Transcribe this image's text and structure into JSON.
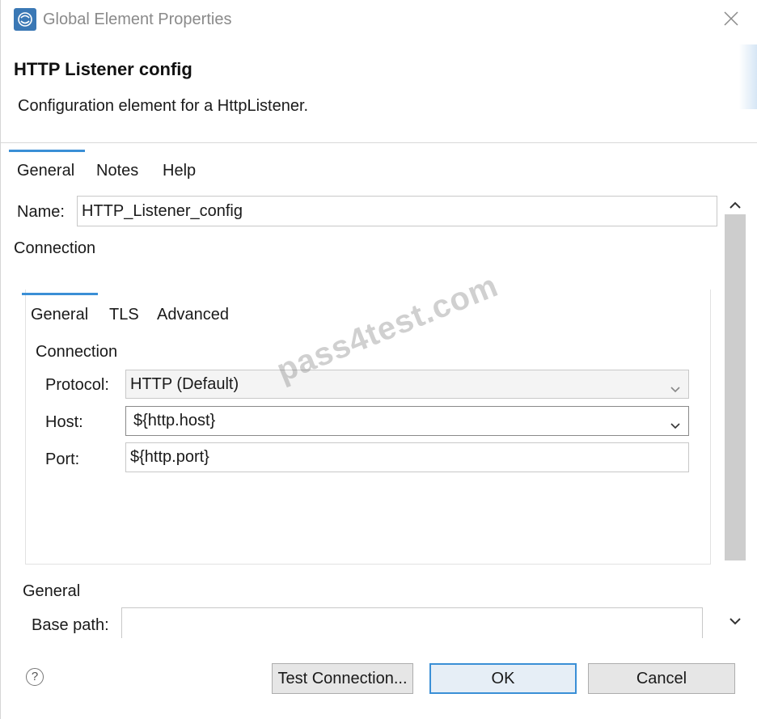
{
  "window": {
    "title": "Global Element Properties"
  },
  "header": {
    "title": "HTTP Listener config",
    "description": "Configuration element for a HttpListener."
  },
  "tabs": [
    {
      "label": "General",
      "active": true
    },
    {
      "label": "Notes",
      "active": false
    },
    {
      "label": "Help",
      "active": false
    }
  ],
  "name_field": {
    "label": "Name:",
    "value": "HTTP_Listener_config"
  },
  "connection_section_label": "Connection",
  "inner_tabs": [
    {
      "label": "General",
      "active": true
    },
    {
      "label": "TLS",
      "active": false
    },
    {
      "label": "Advanced",
      "active": false
    }
  ],
  "connection": {
    "group_label": "Connection",
    "protocol": {
      "label": "Protocol:",
      "value": "HTTP (Default)"
    },
    "host": {
      "label": "Host:",
      "value": "${http.host}"
    },
    "port": {
      "label": "Port:",
      "value": "${http.port}"
    }
  },
  "general_section": {
    "label": "General",
    "base_path": {
      "label": "Base path:",
      "value": ""
    }
  },
  "buttons": {
    "help": "?",
    "test_connection": "Test Connection...",
    "ok": "OK",
    "cancel": "Cancel"
  },
  "watermark": "pass4test.com",
  "colors": {
    "accent": "#3a8fd6",
    "app_icon": "#3a78b5"
  },
  "icons": [
    "anypoint-studio-icon",
    "close-icon",
    "chevron-up-icon",
    "chevron-down-icon",
    "help-icon"
  ]
}
